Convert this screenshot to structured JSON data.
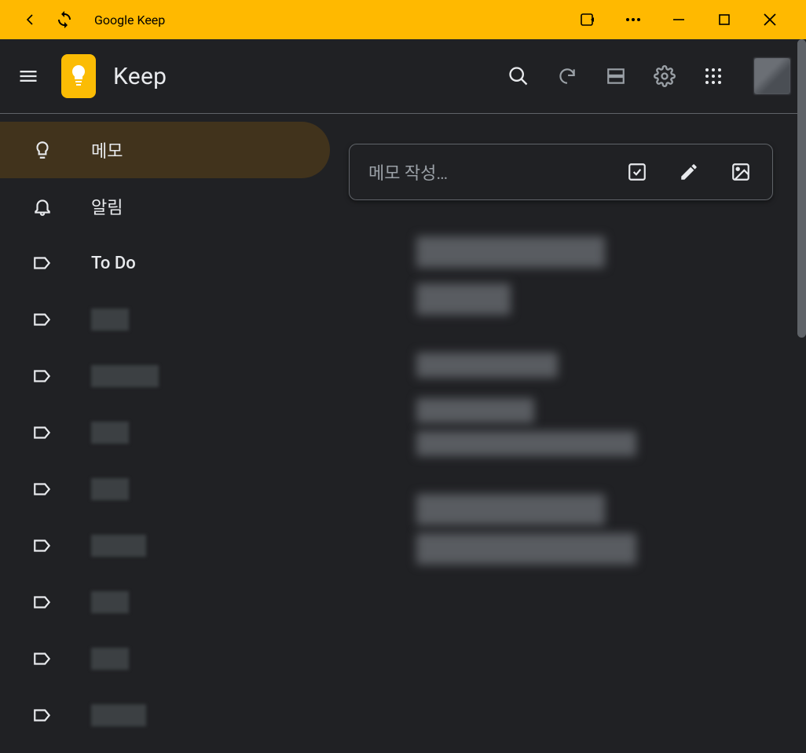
{
  "window": {
    "title": "Google Keep"
  },
  "header": {
    "app_name": "Keep"
  },
  "sidebar": {
    "items": [
      {
        "kind": "notes",
        "label": "메모",
        "icon": "lightbulb",
        "active": true
      },
      {
        "kind": "reminders",
        "label": "알림",
        "icon": "bell",
        "active": false
      },
      {
        "kind": "label",
        "label": "To Do",
        "icon": "label",
        "active": false,
        "bold": true
      },
      {
        "kind": "label",
        "label": "",
        "icon": "label",
        "active": false,
        "redacted": "sm"
      },
      {
        "kind": "label",
        "label": "",
        "icon": "label",
        "active": false,
        "redacted": "lg"
      },
      {
        "kind": "label",
        "label": "",
        "icon": "label",
        "active": false,
        "redacted": "sm"
      },
      {
        "kind": "label",
        "label": "",
        "icon": "label",
        "active": false,
        "redacted": "sm"
      },
      {
        "kind": "label",
        "label": "",
        "icon": "label",
        "active": false,
        "redacted": "md"
      },
      {
        "kind": "label",
        "label": "",
        "icon": "label",
        "active": false,
        "redacted": "sm"
      },
      {
        "kind": "label",
        "label": "",
        "icon": "label",
        "active": false,
        "redacted": "sm"
      },
      {
        "kind": "label",
        "label": "",
        "icon": "label",
        "active": false,
        "redacted": "md"
      }
    ]
  },
  "compose": {
    "placeholder": "메모 작성…"
  },
  "colors": {
    "chrome_bar": "#ffb900",
    "bg": "#202124",
    "accent_active": "#41331c",
    "keep_yellow": "#fbbc04",
    "border": "#5f6368",
    "text_primary": "#e8eaed",
    "text_muted": "#9aa0a6"
  }
}
